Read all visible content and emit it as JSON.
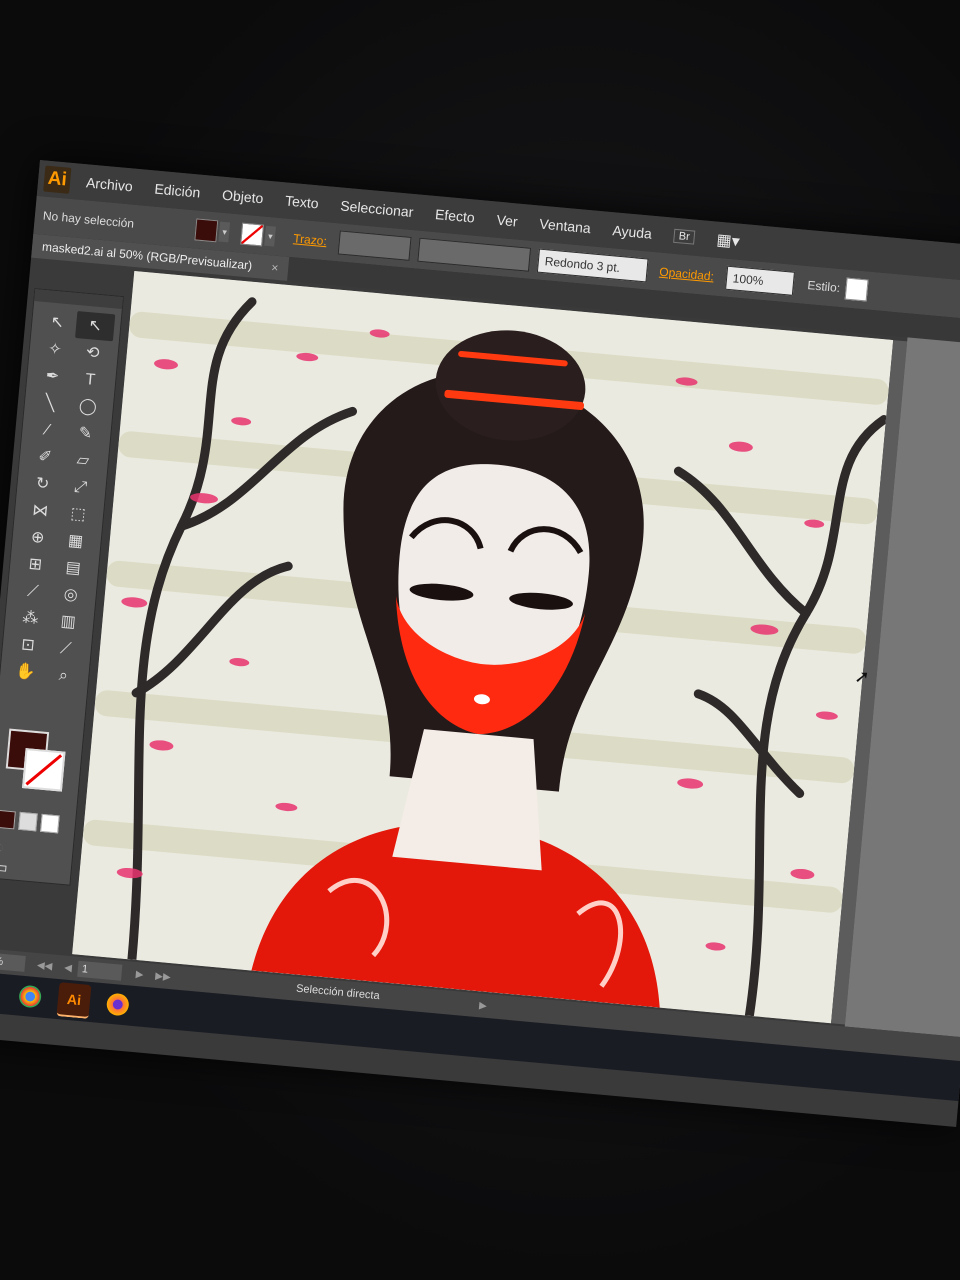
{
  "app": {
    "logo_text": "Ai"
  },
  "menu": [
    "Archivo",
    "Edición",
    "Objeto",
    "Texto",
    "Seleccionar",
    "Efecto",
    "Ver",
    "Ventana",
    "Ayuda"
  ],
  "menu_extra": {
    "bridge_label": "Br"
  },
  "control_bar": {
    "selection_label": "No hay selección",
    "stroke_link": "Trazo:",
    "brush_value": "Redondo 3 pt.",
    "opacity_link": "Opacidad:",
    "opacity_value": "100%",
    "style_label": "Estilo:"
  },
  "document_tab": {
    "title": "masked2.ai al 50% (RGB/Previsualizar)",
    "close": "×"
  },
  "tools": [
    {
      "name": "selection-tool-icon",
      "glyph": "↖",
      "active": false
    },
    {
      "name": "direct-selection-tool-icon",
      "glyph": "↖",
      "active": true
    },
    {
      "name": "magic-wand-tool-icon",
      "glyph": "✧",
      "active": false
    },
    {
      "name": "lasso-tool-icon",
      "glyph": "⟲",
      "active": false
    },
    {
      "name": "pen-tool-icon",
      "glyph": "✒",
      "active": false
    },
    {
      "name": "type-tool-icon",
      "glyph": "T",
      "active": false
    },
    {
      "name": "line-tool-icon",
      "glyph": "╲",
      "active": false
    },
    {
      "name": "ellipse-tool-icon",
      "glyph": "◯",
      "active": false
    },
    {
      "name": "brush-tool-icon",
      "glyph": "∕",
      "active": false
    },
    {
      "name": "pencil-tool-icon",
      "glyph": "✎",
      "active": false
    },
    {
      "name": "blob-brush-tool-icon",
      "glyph": "✐",
      "active": false
    },
    {
      "name": "eraser-tool-icon",
      "glyph": "▱",
      "active": false
    },
    {
      "name": "rotate-tool-icon",
      "glyph": "↻",
      "active": false
    },
    {
      "name": "scale-tool-icon",
      "glyph": "⤢",
      "active": false
    },
    {
      "name": "width-tool-icon",
      "glyph": "⋈",
      "active": false
    },
    {
      "name": "free-transform-tool-icon",
      "glyph": "⬚",
      "active": false
    },
    {
      "name": "shape-builder-tool-icon",
      "glyph": "⊕",
      "active": false
    },
    {
      "name": "perspective-grid-tool-icon",
      "glyph": "▦",
      "active": false
    },
    {
      "name": "mesh-tool-icon",
      "glyph": "⊞",
      "active": false
    },
    {
      "name": "gradient-tool-icon",
      "glyph": "▤",
      "active": false
    },
    {
      "name": "eyedropper-tool-icon",
      "glyph": "⟋",
      "active": false
    },
    {
      "name": "blend-tool-icon",
      "glyph": "◎",
      "active": false
    },
    {
      "name": "symbol-sprayer-tool-icon",
      "glyph": "⁂",
      "active": false
    },
    {
      "name": "column-graph-tool-icon",
      "glyph": "▥",
      "active": false
    },
    {
      "name": "artboard-tool-icon",
      "glyph": "⊡",
      "active": false
    },
    {
      "name": "slice-tool-icon",
      "glyph": "⟋",
      "active": false
    },
    {
      "name": "hand-tool-icon",
      "glyph": "✋",
      "active": false
    },
    {
      "name": "zoom-tool-icon",
      "glyph": "⌕",
      "active": false
    }
  ],
  "colors": {
    "fill": "#3a0c0a",
    "stroke": "#ffffff",
    "accent": "#ff9a00"
  },
  "status_bar": {
    "zoom": "50%",
    "page": "1",
    "tool_status": "Selección directa"
  },
  "taskbar": {
    "ai_label": "Ai"
  }
}
